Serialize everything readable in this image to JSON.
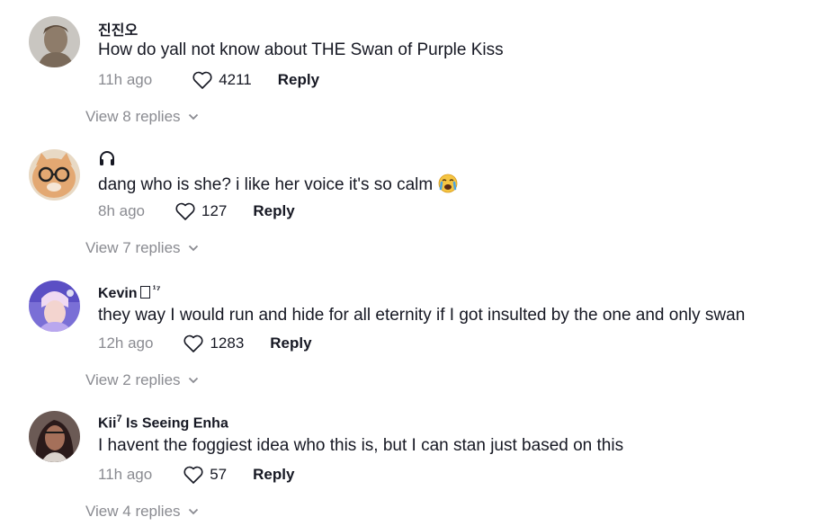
{
  "comments": [
    {
      "username": "진진오",
      "text": "How do yall not know about THE Swan of Purple Kiss",
      "time": "11h ago",
      "likes": "4211",
      "reply_label": "Reply",
      "view_replies": "View 8 replies"
    },
    {
      "username_icon": "headphones-icon",
      "text": "dang who is she? i like her voice it's so calm",
      "time": "8h ago",
      "likes": "127",
      "reply_label": "Reply",
      "view_replies": "View 7 replies"
    },
    {
      "username": "Kevin",
      "username_suffix": "¹⁷",
      "text": "they way I would run and hide for all eternity if I got insulted by the one and only swan",
      "time": "12h ago",
      "likes": "1283",
      "reply_label": "Reply",
      "view_replies": "View 2 replies"
    },
    {
      "username": "Kii",
      "username_sup": "7",
      "username_rest": " Is Seeing Enha",
      "text": "I havent the foggiest idea who this is, but I can stan just based on this",
      "time": "11h ago",
      "likes": "57",
      "reply_label": "Reply",
      "view_replies": "View 4 replies"
    }
  ],
  "colors": {
    "text": "#161823",
    "muted": "#8a8b91",
    "background": "#ffffff"
  },
  "emoji": "crying-face-emoji"
}
